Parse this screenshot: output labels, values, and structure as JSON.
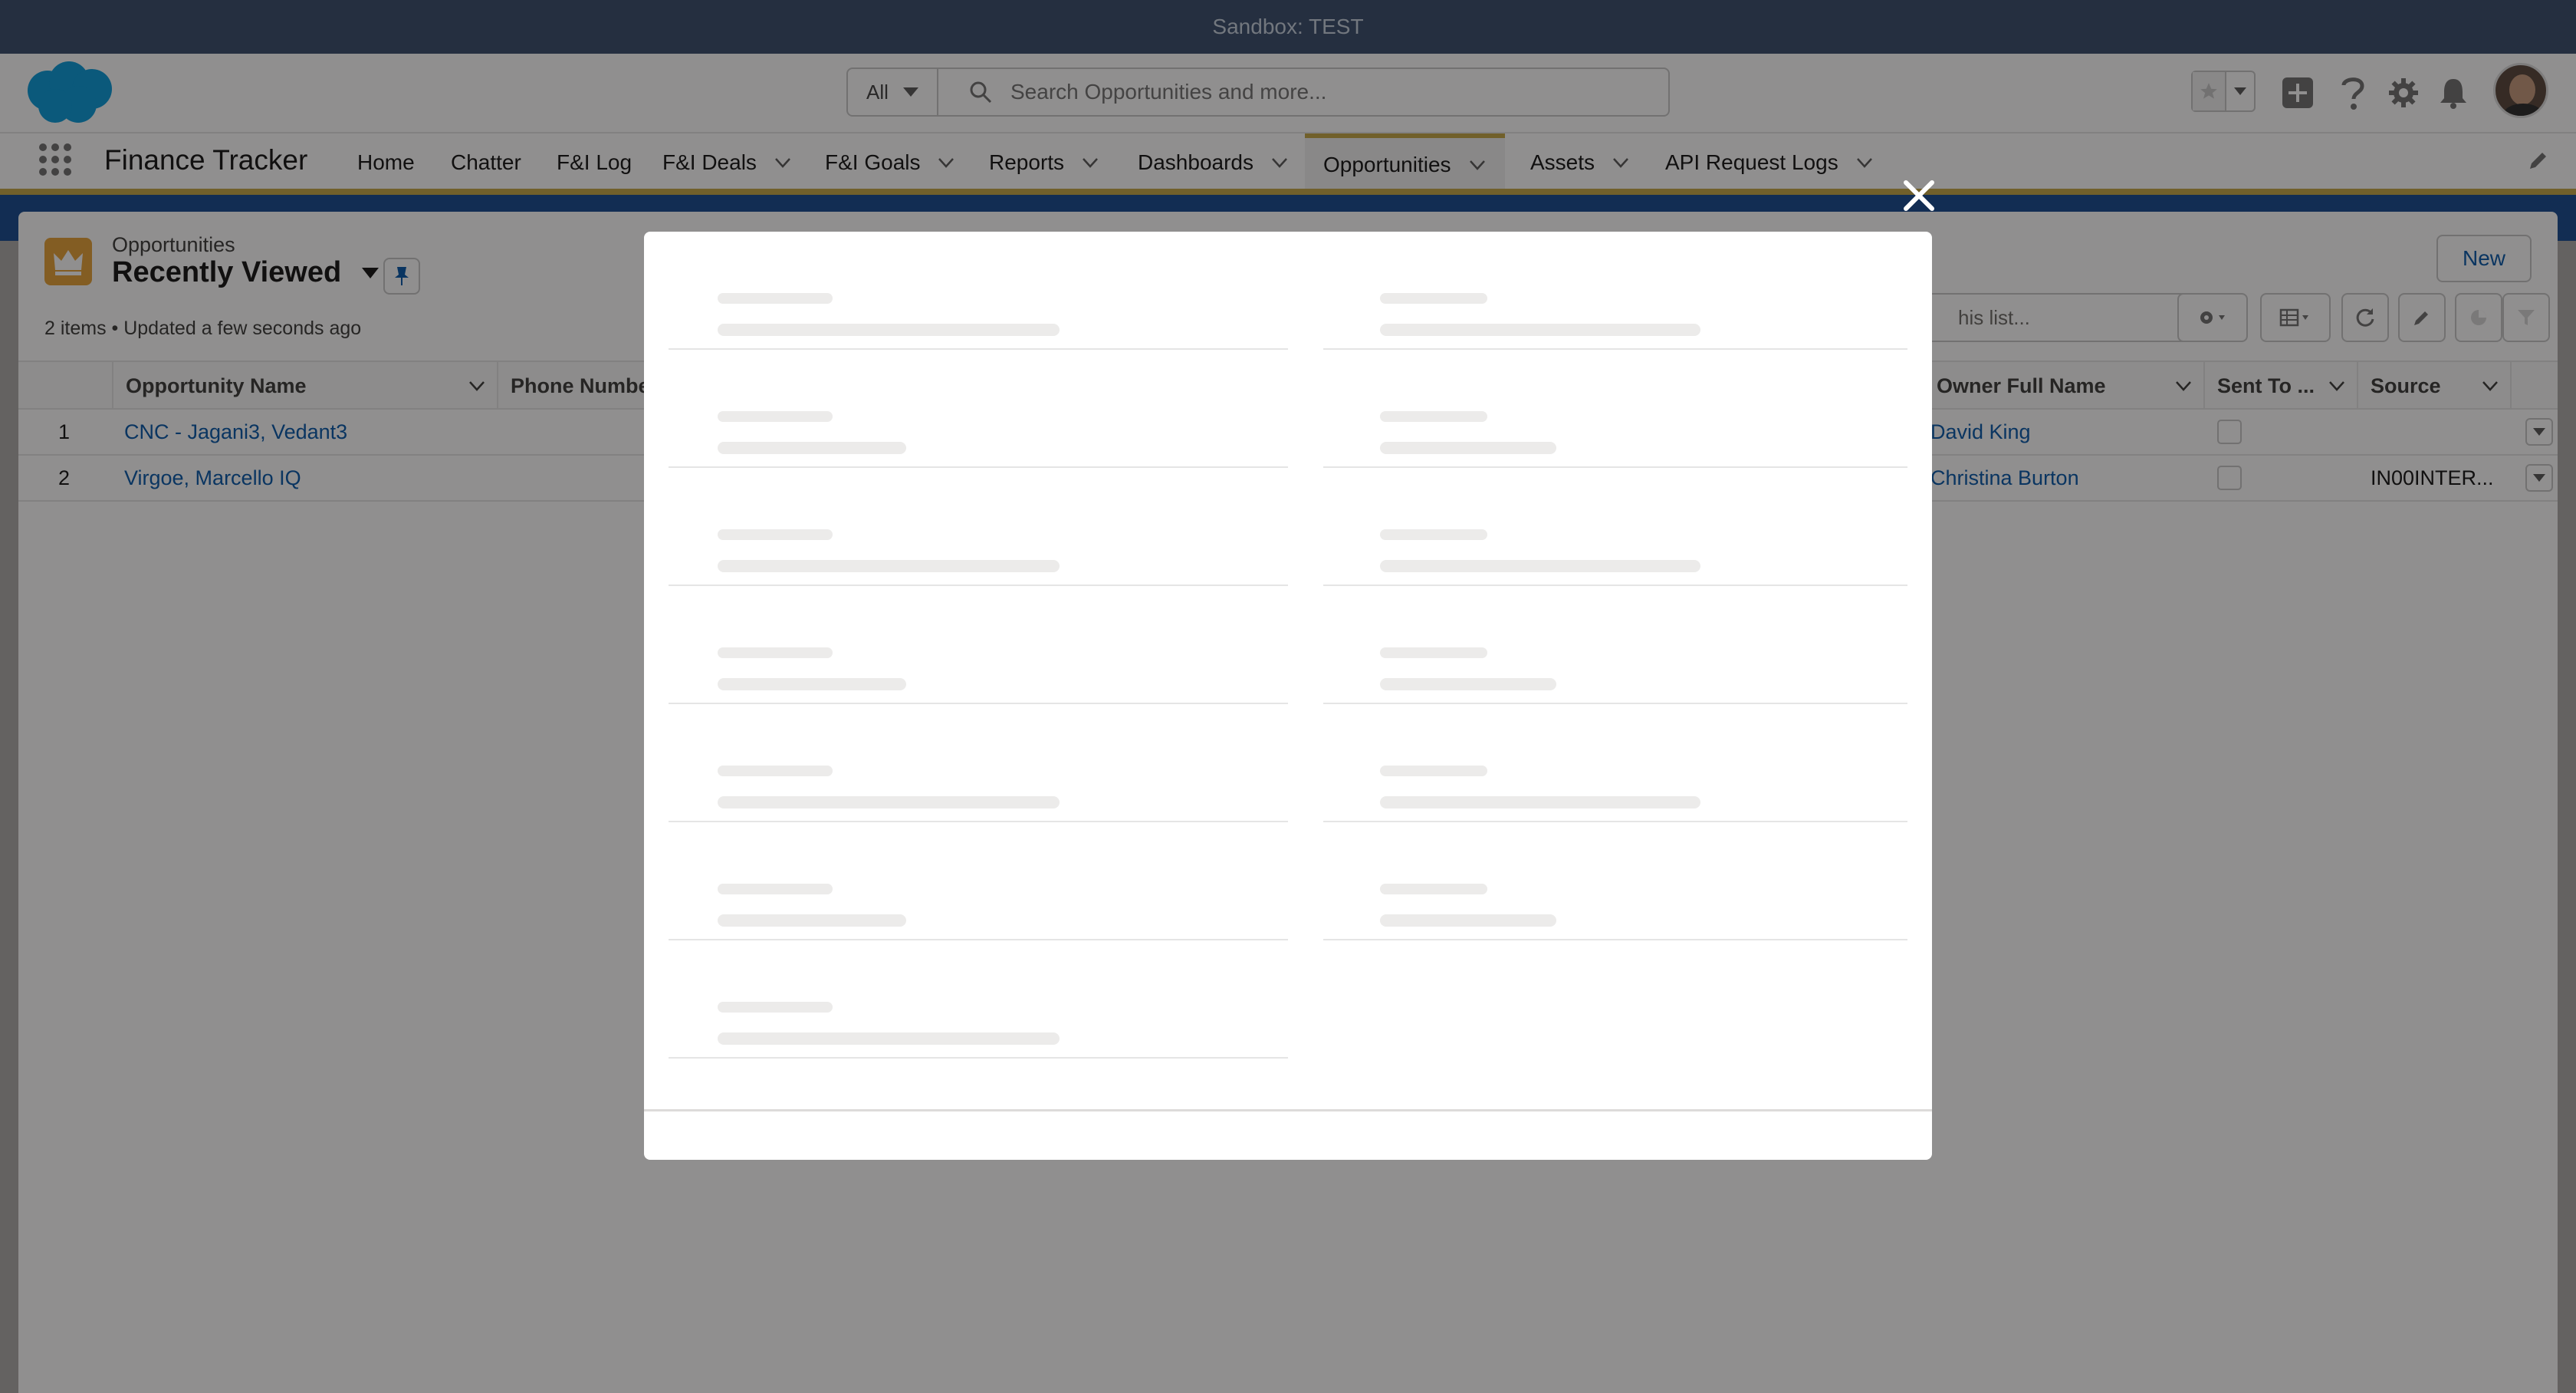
{
  "sandbox_bar": {
    "label": "Sandbox: TEST"
  },
  "global_header": {
    "search_scope": "All",
    "search_placeholder": "Search Opportunities and more...",
    "icons": [
      "favorites-star-icon",
      "favorites-menu-icon",
      "global-actions-add-icon",
      "help-icon",
      "setup-gear-icon",
      "notifications-bell-icon",
      "user-avatar"
    ]
  },
  "nav": {
    "app_name": "Finance Tracker",
    "items": [
      {
        "label": "Home",
        "has_menu": false
      },
      {
        "label": "Chatter",
        "has_menu": false
      },
      {
        "label": "F&I Log",
        "has_menu": false
      },
      {
        "label": "F&I Deals",
        "has_menu": true
      },
      {
        "label": "F&I Goals",
        "has_menu": true
      },
      {
        "label": "Reports",
        "has_menu": true
      },
      {
        "label": "Dashboards",
        "has_menu": true
      },
      {
        "label": "Opportunities",
        "has_menu": true,
        "active": true
      },
      {
        "label": "Assets",
        "has_menu": true
      },
      {
        "label": "API Request Logs",
        "has_menu": true
      }
    ]
  },
  "list_view": {
    "object_label": "Opportunities",
    "list_name": "Recently Viewed",
    "meta": "2 items • Updated a few seconds ago",
    "new_button": "New",
    "search_placeholder": "his list...",
    "columns": [
      "Opportunity Name",
      "Phone Number",
      "Owner Full Name",
      "Sent To ...",
      "Source"
    ],
    "rows": [
      {
        "num": "1",
        "name": "CNC - Jagani3, Vedant3",
        "phone": "",
        "owner": "David King",
        "sent_to": false,
        "source": ""
      },
      {
        "num": "2",
        "name": "Virgoe, Marcello IQ",
        "phone": "",
        "owner": "Christina Burton",
        "sent_to": false,
        "source": "IN00INTER..."
      }
    ]
  },
  "modal": {
    "state": "loading",
    "left_placeholder_rows": 7,
    "right_placeholder_rows": 6
  },
  "colors": {
    "brand_blue": "#0b5cab",
    "sandbox_bar": "#3d5170",
    "nav_accent": "#c7a94a",
    "object_icon": "#e8a53b"
  }
}
